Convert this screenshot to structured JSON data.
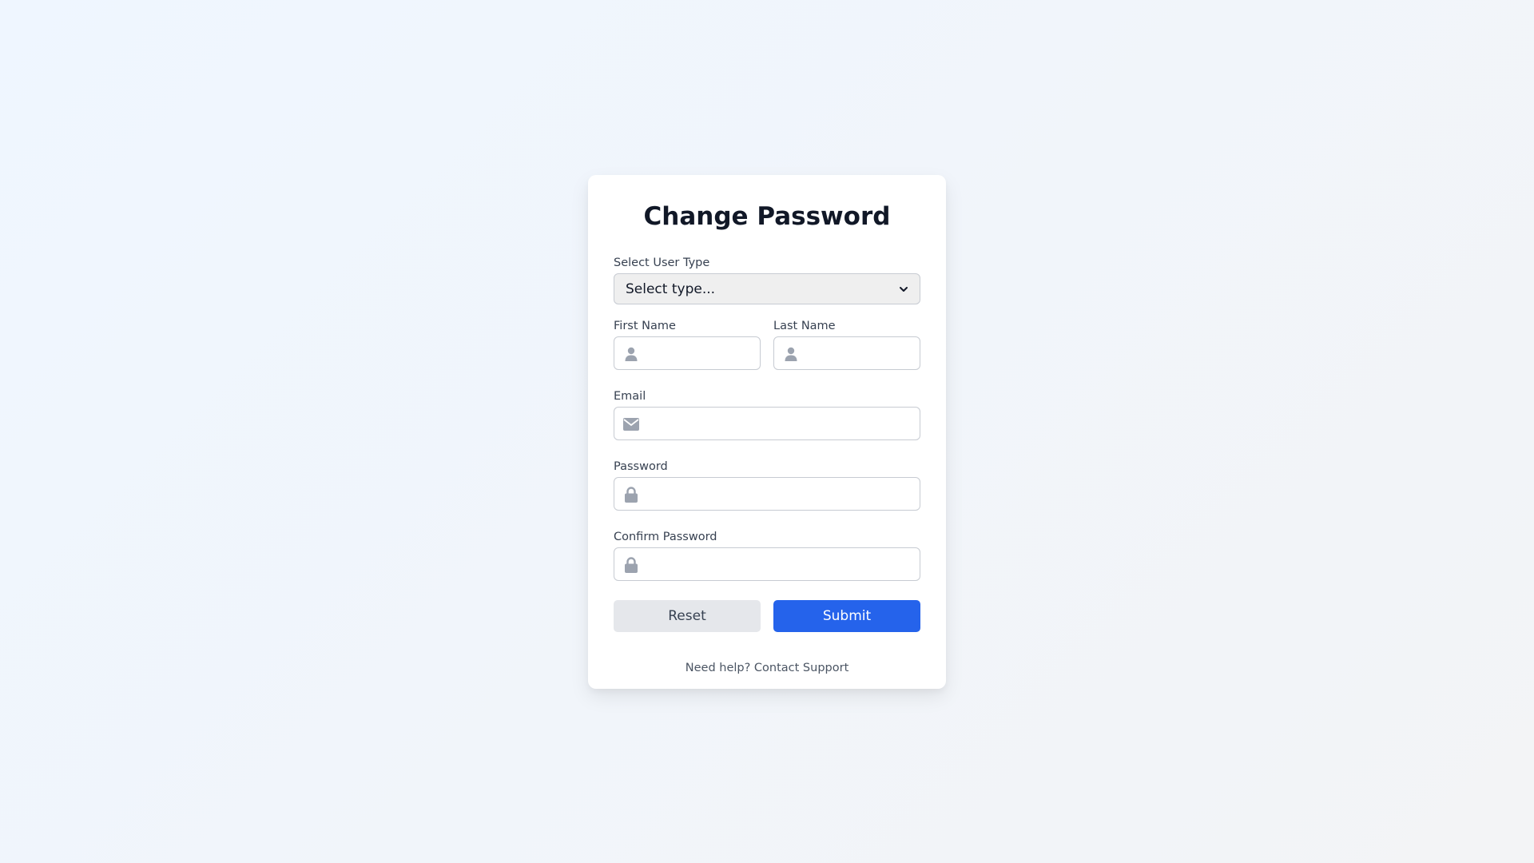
{
  "form": {
    "title": "Change Password",
    "user_type": {
      "label": "Select User Type",
      "selected": "Select type..."
    },
    "first_name": {
      "label": "First Name",
      "value": ""
    },
    "last_name": {
      "label": "Last Name",
      "value": ""
    },
    "email": {
      "label": "Email",
      "value": ""
    },
    "password": {
      "label": "Password",
      "value": ""
    },
    "confirm_password": {
      "label": "Confirm Password",
      "value": ""
    },
    "reset_label": "Reset",
    "submit_label": "Submit",
    "help_text": "Need help?",
    "help_link": "Contact Support"
  },
  "colors": {
    "primary": "#2563eb",
    "secondary": "#e5e7eb",
    "icon": "#9ca3af"
  },
  "icons": {
    "first_name": "user-icon",
    "last_name": "user-icon",
    "email": "envelope-icon",
    "password": "lock-icon",
    "confirm_password": "lock-icon",
    "select": "chevron-down-icon"
  }
}
